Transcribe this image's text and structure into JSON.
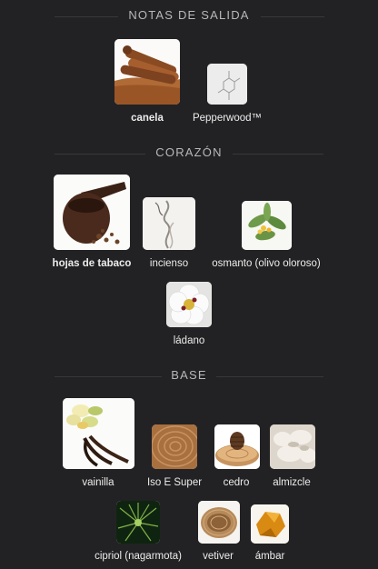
{
  "sections": [
    {
      "title": "NOTAS DE SALIDA",
      "notes": [
        {
          "label": "canela",
          "icon": "cinnamon-icon"
        },
        {
          "label": "Pepperwood™",
          "icon": "molecule-icon"
        }
      ]
    },
    {
      "title": "CORAZÓN",
      "notes": [
        {
          "label": "hojas de tabaco",
          "icon": "tobacco-pipe-icon"
        },
        {
          "label": "incienso",
          "icon": "incense-smoke-icon"
        },
        {
          "label": "osmanto (olivo oloroso)",
          "icon": "osmanthus-icon"
        },
        {
          "label": "ládano",
          "icon": "cistus-flower-icon"
        }
      ]
    },
    {
      "title": "BASE",
      "notes": [
        {
          "label": "vainilla",
          "icon": "vanilla-icon"
        },
        {
          "label": "Iso E Super",
          "icon": "wood-grain-icon"
        },
        {
          "label": "cedro",
          "icon": "cedar-cone-icon"
        },
        {
          "label": "almizcle",
          "icon": "musk-fur-icon"
        },
        {
          "label": "cipriol (nagarmota)",
          "icon": "cypriol-grass-icon"
        },
        {
          "label": "vetiver",
          "icon": "vetiver-nest-icon"
        },
        {
          "label": "ámbar",
          "icon": "amber-icon"
        }
      ]
    }
  ]
}
